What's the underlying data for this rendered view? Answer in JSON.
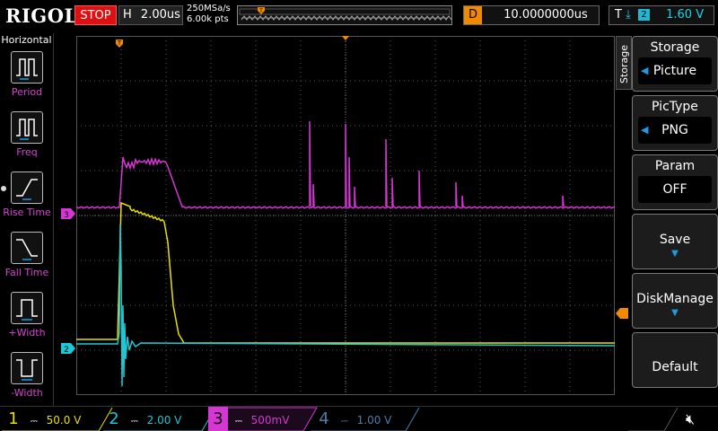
{
  "topbar": {
    "brand": "RIGOL",
    "run_state": "STOP",
    "timebase_label": "H",
    "timebase_value": "2.00us",
    "sample_rate": "250MSa/s",
    "memory_depth": "6.00k pts",
    "delay_label": "D",
    "delay_value": "10.0000000us",
    "trigger_label": "T",
    "trigger_source": "2",
    "trigger_level": "1.60 V"
  },
  "left_panel": {
    "title": "Horizontal",
    "items": [
      {
        "label": "Period",
        "icon": "period-icon"
      },
      {
        "label": "Freq",
        "icon": "frequency-icon"
      },
      {
        "label": "Rise Time",
        "icon": "rise-time-icon"
      },
      {
        "label": "Fall Time",
        "icon": "fall-time-icon"
      },
      {
        "label": "+Width",
        "icon": "positive-width-icon"
      },
      {
        "label": "-Width",
        "icon": "negative-width-icon"
      }
    ]
  },
  "right_panel": {
    "tab": "Storage",
    "menus": [
      {
        "title": "Storage",
        "value": "Picture"
      },
      {
        "title": "PicType",
        "value": "PNG"
      },
      {
        "title": "Param",
        "value": "OFF"
      },
      {
        "title": "Save"
      },
      {
        "title": "DiskManage"
      },
      {
        "title": "Default"
      }
    ]
  },
  "channels": [
    {
      "num": "1",
      "scale": "50.0 V",
      "color": "#e8e000",
      "enabled": true
    },
    {
      "num": "2",
      "scale": "2.00 V",
      "color": "#1fc7d4",
      "enabled": true
    },
    {
      "num": "3",
      "scale": "500mV",
      "color": "#d636d4",
      "enabled": true
    },
    {
      "num": "4",
      "scale": "1.00 V",
      "color": "#4d7fa6",
      "enabled": false
    }
  ],
  "markers": {
    "ch3_marker": "3",
    "ch2_marker": "2",
    "trigger_marker": "T"
  },
  "colors": {
    "ch1": "#e8e000",
    "ch2": "#1fc7d4",
    "ch3": "#d636d4",
    "trigger": "#f28a00",
    "accent": "#1e9be5"
  }
}
